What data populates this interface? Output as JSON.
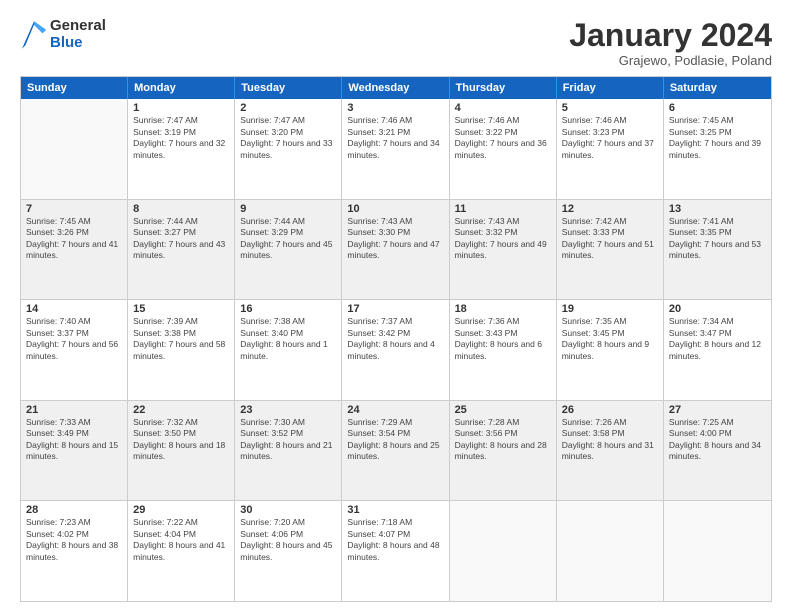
{
  "logo": {
    "general": "General",
    "blue": "Blue"
  },
  "title": "January 2024",
  "subtitle": "Grajewo, Podlasie, Poland",
  "calendar": {
    "headers": [
      "Sunday",
      "Monday",
      "Tuesday",
      "Wednesday",
      "Thursday",
      "Friday",
      "Saturday"
    ],
    "rows": [
      [
        {
          "day": "",
          "sunrise": "",
          "sunset": "",
          "daylight": ""
        },
        {
          "day": "1",
          "sunrise": "Sunrise: 7:47 AM",
          "sunset": "Sunset: 3:19 PM",
          "daylight": "Daylight: 7 hours and 32 minutes."
        },
        {
          "day": "2",
          "sunrise": "Sunrise: 7:47 AM",
          "sunset": "Sunset: 3:20 PM",
          "daylight": "Daylight: 7 hours and 33 minutes."
        },
        {
          "day": "3",
          "sunrise": "Sunrise: 7:46 AM",
          "sunset": "Sunset: 3:21 PM",
          "daylight": "Daylight: 7 hours and 34 minutes."
        },
        {
          "day": "4",
          "sunrise": "Sunrise: 7:46 AM",
          "sunset": "Sunset: 3:22 PM",
          "daylight": "Daylight: 7 hours and 36 minutes."
        },
        {
          "day": "5",
          "sunrise": "Sunrise: 7:46 AM",
          "sunset": "Sunset: 3:23 PM",
          "daylight": "Daylight: 7 hours and 37 minutes."
        },
        {
          "day": "6",
          "sunrise": "Sunrise: 7:45 AM",
          "sunset": "Sunset: 3:25 PM",
          "daylight": "Daylight: 7 hours and 39 minutes."
        }
      ],
      [
        {
          "day": "7",
          "sunrise": "Sunrise: 7:45 AM",
          "sunset": "Sunset: 3:26 PM",
          "daylight": "Daylight: 7 hours and 41 minutes."
        },
        {
          "day": "8",
          "sunrise": "Sunrise: 7:44 AM",
          "sunset": "Sunset: 3:27 PM",
          "daylight": "Daylight: 7 hours and 43 minutes."
        },
        {
          "day": "9",
          "sunrise": "Sunrise: 7:44 AM",
          "sunset": "Sunset: 3:29 PM",
          "daylight": "Daylight: 7 hours and 45 minutes."
        },
        {
          "day": "10",
          "sunrise": "Sunrise: 7:43 AM",
          "sunset": "Sunset: 3:30 PM",
          "daylight": "Daylight: 7 hours and 47 minutes."
        },
        {
          "day": "11",
          "sunrise": "Sunrise: 7:43 AM",
          "sunset": "Sunset: 3:32 PM",
          "daylight": "Daylight: 7 hours and 49 minutes."
        },
        {
          "day": "12",
          "sunrise": "Sunrise: 7:42 AM",
          "sunset": "Sunset: 3:33 PM",
          "daylight": "Daylight: 7 hours and 51 minutes."
        },
        {
          "day": "13",
          "sunrise": "Sunrise: 7:41 AM",
          "sunset": "Sunset: 3:35 PM",
          "daylight": "Daylight: 7 hours and 53 minutes."
        }
      ],
      [
        {
          "day": "14",
          "sunrise": "Sunrise: 7:40 AM",
          "sunset": "Sunset: 3:37 PM",
          "daylight": "Daylight: 7 hours and 56 minutes."
        },
        {
          "day": "15",
          "sunrise": "Sunrise: 7:39 AM",
          "sunset": "Sunset: 3:38 PM",
          "daylight": "Daylight: 7 hours and 58 minutes."
        },
        {
          "day": "16",
          "sunrise": "Sunrise: 7:38 AM",
          "sunset": "Sunset: 3:40 PM",
          "daylight": "Daylight: 8 hours and 1 minute."
        },
        {
          "day": "17",
          "sunrise": "Sunrise: 7:37 AM",
          "sunset": "Sunset: 3:42 PM",
          "daylight": "Daylight: 8 hours and 4 minutes."
        },
        {
          "day": "18",
          "sunrise": "Sunrise: 7:36 AM",
          "sunset": "Sunset: 3:43 PM",
          "daylight": "Daylight: 8 hours and 6 minutes."
        },
        {
          "day": "19",
          "sunrise": "Sunrise: 7:35 AM",
          "sunset": "Sunset: 3:45 PM",
          "daylight": "Daylight: 8 hours and 9 minutes."
        },
        {
          "day": "20",
          "sunrise": "Sunrise: 7:34 AM",
          "sunset": "Sunset: 3:47 PM",
          "daylight": "Daylight: 8 hours and 12 minutes."
        }
      ],
      [
        {
          "day": "21",
          "sunrise": "Sunrise: 7:33 AM",
          "sunset": "Sunset: 3:49 PM",
          "daylight": "Daylight: 8 hours and 15 minutes."
        },
        {
          "day": "22",
          "sunrise": "Sunrise: 7:32 AM",
          "sunset": "Sunset: 3:50 PM",
          "daylight": "Daylight: 8 hours and 18 minutes."
        },
        {
          "day": "23",
          "sunrise": "Sunrise: 7:30 AM",
          "sunset": "Sunset: 3:52 PM",
          "daylight": "Daylight: 8 hours and 21 minutes."
        },
        {
          "day": "24",
          "sunrise": "Sunrise: 7:29 AM",
          "sunset": "Sunset: 3:54 PM",
          "daylight": "Daylight: 8 hours and 25 minutes."
        },
        {
          "day": "25",
          "sunrise": "Sunrise: 7:28 AM",
          "sunset": "Sunset: 3:56 PM",
          "daylight": "Daylight: 8 hours and 28 minutes."
        },
        {
          "day": "26",
          "sunrise": "Sunrise: 7:26 AM",
          "sunset": "Sunset: 3:58 PM",
          "daylight": "Daylight: 8 hours and 31 minutes."
        },
        {
          "day": "27",
          "sunrise": "Sunrise: 7:25 AM",
          "sunset": "Sunset: 4:00 PM",
          "daylight": "Daylight: 8 hours and 34 minutes."
        }
      ],
      [
        {
          "day": "28",
          "sunrise": "Sunrise: 7:23 AM",
          "sunset": "Sunset: 4:02 PM",
          "daylight": "Daylight: 8 hours and 38 minutes."
        },
        {
          "day": "29",
          "sunrise": "Sunrise: 7:22 AM",
          "sunset": "Sunset: 4:04 PM",
          "daylight": "Daylight: 8 hours and 41 minutes."
        },
        {
          "day": "30",
          "sunrise": "Sunrise: 7:20 AM",
          "sunset": "Sunset: 4:06 PM",
          "daylight": "Daylight: 8 hours and 45 minutes."
        },
        {
          "day": "31",
          "sunrise": "Sunrise: 7:18 AM",
          "sunset": "Sunset: 4:07 PM",
          "daylight": "Daylight: 8 hours and 48 minutes."
        },
        {
          "day": "",
          "sunrise": "",
          "sunset": "",
          "daylight": ""
        },
        {
          "day": "",
          "sunrise": "",
          "sunset": "",
          "daylight": ""
        },
        {
          "day": "",
          "sunrise": "",
          "sunset": "",
          "daylight": ""
        }
      ]
    ]
  }
}
